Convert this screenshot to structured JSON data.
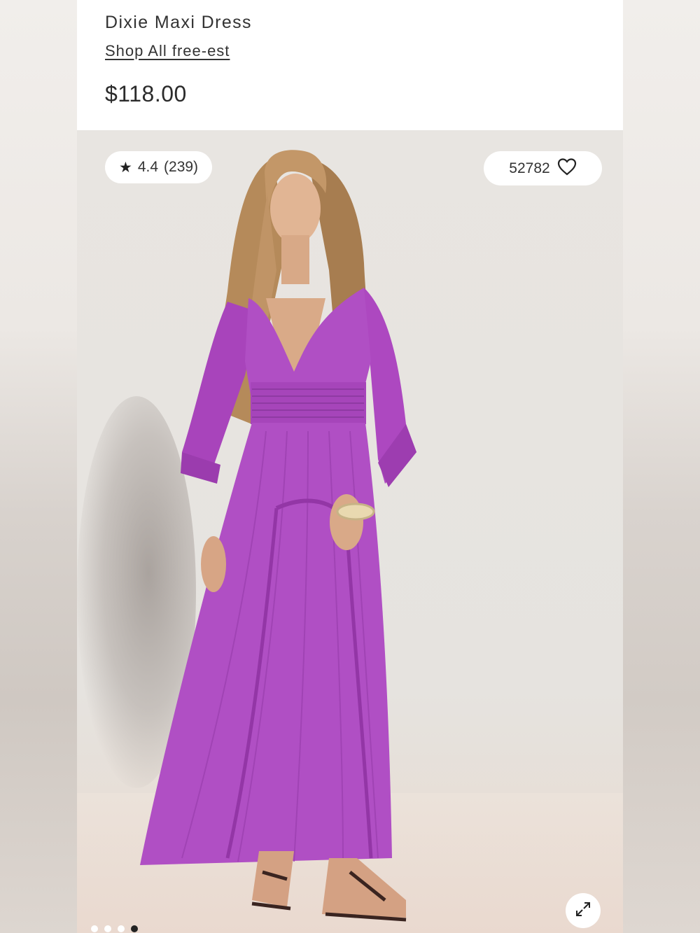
{
  "product": {
    "title": "Dixie Maxi Dress",
    "shop_link": "Shop All free-est",
    "price": "$118.00"
  },
  "rating": {
    "icon": "star-icon",
    "value": "4.4",
    "count": "(239)"
  },
  "likes": {
    "count": "52782",
    "icon": "heart-outline-icon"
  },
  "gallery": {
    "expand_icon": "expand-arrows-icon",
    "dots_total": 4,
    "active_dot": 4
  },
  "colors": {
    "dress": "#b04fc4",
    "background": "#e6e3df"
  }
}
